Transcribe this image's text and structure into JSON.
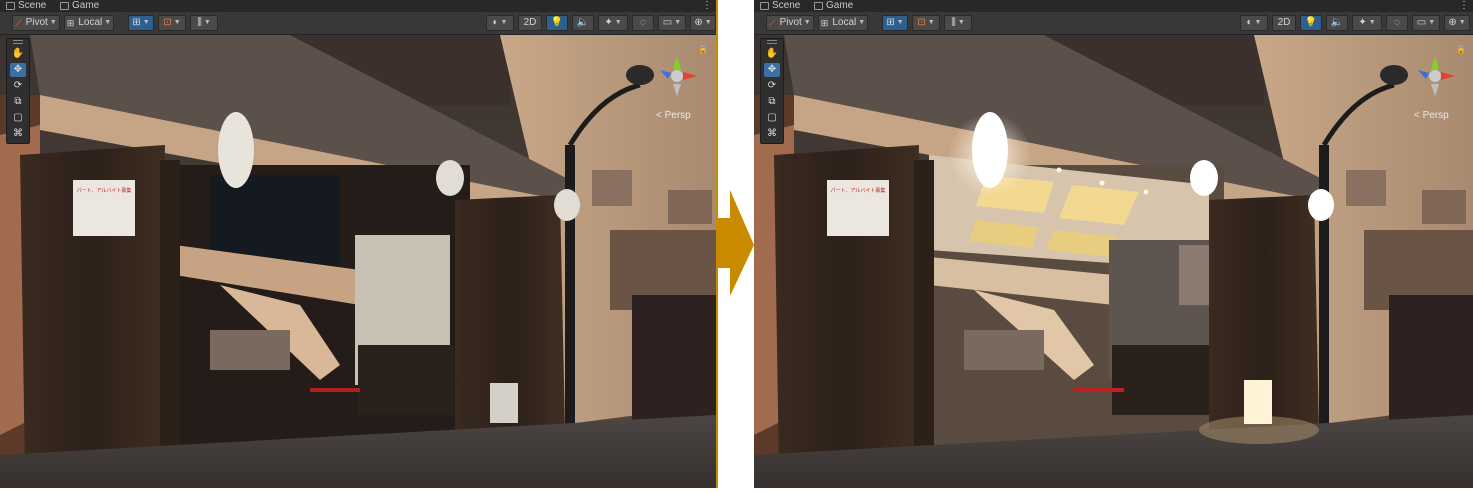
{
  "colors": {
    "arrow": "#c98a00",
    "panel_border": "#c98a00",
    "toolbar_bg": "#383838",
    "tab_bg": "#282828",
    "active_button": "#2f5f8f"
  },
  "tabs": {
    "scene": "Scene",
    "game": "Game",
    "menu": "⋮"
  },
  "toolbar": {
    "pivot": "Pivot",
    "local": "Local",
    "mode_2d": "2D"
  },
  "tools": [
    "hand-tool-icon",
    "move-tool-icon",
    "rotate-tool-icon",
    "scale-tool-icon",
    "rect-tool-icon",
    "transform-tool-icon"
  ],
  "viewport": {
    "persp_label": "< Persp",
    "poster_title": "パート、アルバイト募集"
  },
  "panels": {
    "left": {
      "state": "before",
      "ceiling_lights": false
    },
    "right": {
      "state": "after",
      "ceiling_lights": true
    }
  }
}
